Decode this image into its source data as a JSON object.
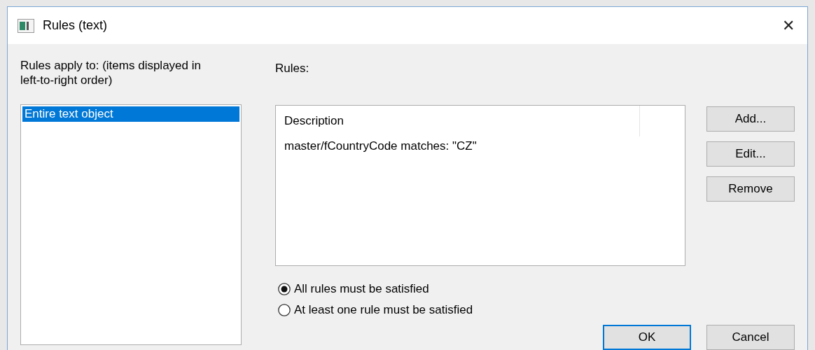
{
  "window": {
    "title": "Rules (text)",
    "close": "✕"
  },
  "apply_to": {
    "label": "Rules apply to: (items displayed in left-to-right order)",
    "items": [
      {
        "label": "Entire text object",
        "selected": true
      }
    ]
  },
  "rules": {
    "label": "Rules:",
    "columns": [
      "Description"
    ],
    "rows": [
      "master/fCountryCode matches: \"CZ\""
    ]
  },
  "side_buttons": [
    "Add...",
    "Edit...",
    "Remove"
  ],
  "match_options": [
    {
      "label": "All rules must be satisfied",
      "selected": true
    },
    {
      "label": "At least one rule must be satisfied",
      "selected": false
    }
  ],
  "buttons": [
    {
      "label": "OK",
      "default": true
    },
    {
      "label": "Cancel",
      "default": false
    }
  ]
}
